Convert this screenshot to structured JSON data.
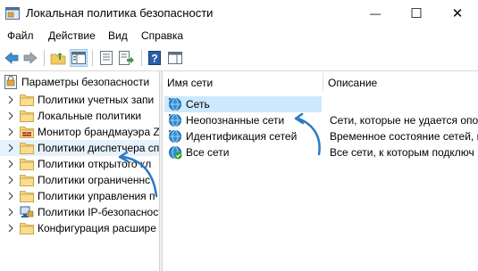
{
  "window": {
    "title": "Локальная политика безопасности",
    "controls": {
      "minimize": "—",
      "maximize": "☐",
      "close": "✕"
    }
  },
  "menu": [
    "Файл",
    "Действие",
    "Вид",
    "Справка"
  ],
  "toolbar": {
    "buttons": [
      "back-icon",
      "forward-icon",
      "up-folder-icon",
      "show-hide-tree-icon",
      "properties-icon",
      "export-list-icon",
      "help-icon",
      "console-icon"
    ]
  },
  "tree": {
    "root": "Параметры безопасности",
    "items": [
      {
        "label": "Политики учетных запи",
        "icon": "folder-icon"
      },
      {
        "label": "Локальные политики",
        "icon": "folder-icon"
      },
      {
        "label": "Монитор брандмауэра Zi",
        "icon": "firewall-folder-icon"
      },
      {
        "label": "Политики диспетчера сп",
        "icon": "folder-icon",
        "selected": true
      },
      {
        "label": "Политики открытого кл",
        "icon": "folder-icon"
      },
      {
        "label": "Политики ограниченнс",
        "icon": "folder-icon"
      },
      {
        "label": "Политики управления п",
        "icon": "folder-icon"
      },
      {
        "label": "Политики IP-безопасност",
        "icon": "ipsec-icon"
      },
      {
        "label": "Конфигурация расшире",
        "icon": "folder-icon"
      }
    ]
  },
  "list": {
    "columns": [
      "Имя сети",
      "Описание"
    ],
    "rows": [
      {
        "name": "Сеть",
        "description": "",
        "icon": "network-icon",
        "selected": true
      },
      {
        "name": "Неопознанные сети",
        "description": "Сети, которые не удается опоз",
        "icon": "network-icon"
      },
      {
        "name": "Идентификация сетей",
        "description": "Временное состояние сетей, кот",
        "icon": "network-icon"
      },
      {
        "name": "Все сети",
        "description": "Все сети, к которым подключ",
        "icon": "network-check-icon"
      }
    ]
  },
  "colors": {
    "selection": "#cce8ff",
    "tree_selection": "#e5f1fb",
    "annotation_arrow": "#2b7ac4"
  }
}
